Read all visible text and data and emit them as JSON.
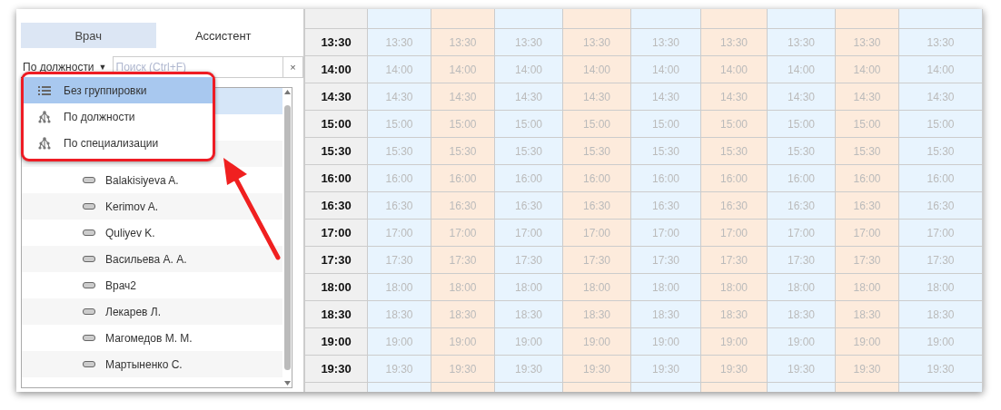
{
  "tabs": [
    {
      "label": "Врач",
      "selected": true
    },
    {
      "label": "Ассистент",
      "selected": false
    }
  ],
  "grouping": {
    "value": "По должности",
    "caret": "▼"
  },
  "search": {
    "placeholder": "Поиск (Ctrl+F)",
    "clear": "×"
  },
  "grouping_menu": [
    {
      "label": "Без группировки",
      "kind": "list",
      "selected": true
    },
    {
      "label": "По должности",
      "kind": "tree",
      "selected": false
    },
    {
      "label": "По специализации",
      "kind": "tree",
      "selected": false
    }
  ],
  "doctors": [
    "Balakisiyeva A.",
    "Kerimov A.",
    "Quliyev K.",
    "Васильева А. А.",
    "Врач2",
    "Лекарев Л.",
    "Магомедов М. М.",
    "Мартыненко С."
  ],
  "schedule": {
    "columns": [
      {
        "color": "#e8f4fe"
      },
      {
        "color": "#fdebdc"
      },
      {
        "color": "#e8f4fe"
      },
      {
        "color": "#fdebdc"
      },
      {
        "color": "#e8f4fe"
      },
      {
        "color": "#fdebdc"
      },
      {
        "color": "#e8f4fe"
      },
      {
        "color": "#fdebdc"
      },
      {
        "color": "#e8f4fe"
      }
    ],
    "rows": [
      {
        "time": "13:30",
        "slots": [
          "13:30",
          "13:30",
          "13:30",
          "13:30",
          "13:30",
          "13:30",
          "13:30",
          "13:30",
          "13:30"
        ]
      },
      {
        "time": "14:00",
        "slots": [
          "14:00",
          "14:00",
          "14:00",
          "14:00",
          "14:00",
          "14:00",
          "14:00",
          "14:00",
          "14:00"
        ]
      },
      {
        "time": "14:30",
        "slots": [
          "14:30",
          "14:30",
          "14:30",
          "14:30",
          "14:30",
          "14:30",
          "14:30",
          "14:30",
          "14:30"
        ]
      },
      {
        "time": "15:00",
        "slots": [
          "15:00",
          "15:00",
          "15:00",
          "15:00",
          "15:00",
          "15:00",
          "15:00",
          "15:00",
          "15:00"
        ]
      },
      {
        "time": "15:30",
        "slots": [
          "15:30",
          "15:30",
          "15:30",
          "15:30",
          "15:30",
          "15:30",
          "15:30",
          "15:30",
          "15:30"
        ]
      },
      {
        "time": "16:00",
        "slots": [
          "16:00",
          "16:00",
          "16:00",
          "16:00",
          "16:00",
          "16:00",
          "16:00",
          "16:00",
          "16:00"
        ]
      },
      {
        "time": "16:30",
        "slots": [
          "16:30",
          "16:30",
          "16:30",
          "16:30",
          "16:30",
          "16:30",
          "16:30",
          "16:30",
          "16:30"
        ]
      },
      {
        "time": "17:00",
        "slots": [
          "17:00",
          "17:00",
          "17:00",
          "17:00",
          "17:00",
          "17:00",
          "17:00",
          "17:00",
          "17:00"
        ]
      },
      {
        "time": "17:30",
        "slots": [
          "17:30",
          "17:30",
          "17:30",
          "17:30",
          "17:30",
          "17:30",
          "17:30",
          "17:30",
          "17:30"
        ]
      },
      {
        "time": "18:00",
        "slots": [
          "18:00",
          "18:00",
          "18:00",
          "18:00",
          "18:00",
          "18:00",
          "18:00",
          "18:00",
          "18:00"
        ]
      },
      {
        "time": "18:30",
        "slots": [
          "18:30",
          "18:30",
          "18:30",
          "18:30",
          "18:30",
          "18:30",
          "18:30",
          "18:30",
          "18:30"
        ]
      },
      {
        "time": "19:00",
        "slots": [
          "19:00",
          "19:00",
          "19:00",
          "19:00",
          "19:00",
          "19:00",
          "19:00",
          "19:00",
          "19:00"
        ]
      },
      {
        "time": "19:30",
        "slots": [
          "19:30",
          "19:30",
          "19:30",
          "19:30",
          "19:30",
          "19:30",
          "19:30",
          "19:30",
          "19:30"
        ]
      }
    ]
  }
}
